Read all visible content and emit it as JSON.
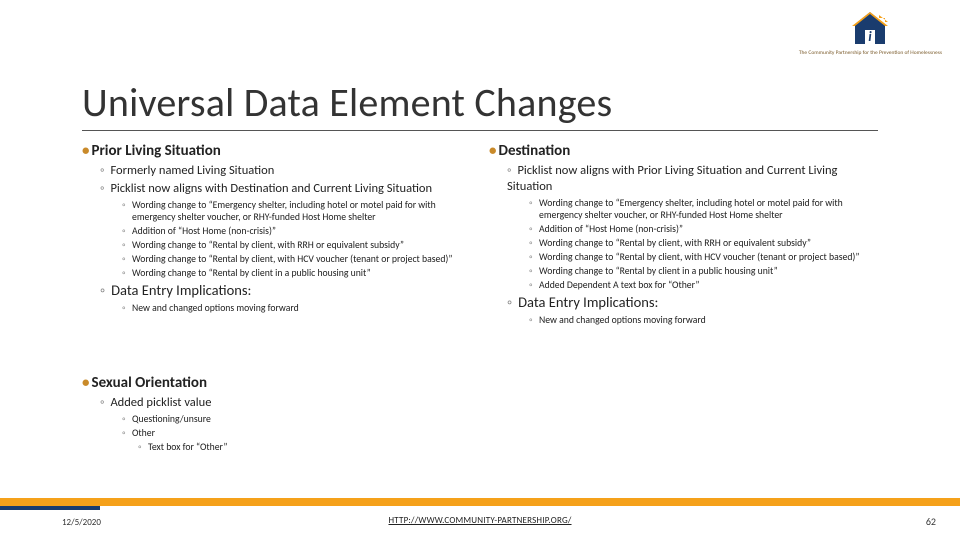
{
  "logo_caption": "The Community Partnership\nfor the Prevention\nof Homelessness",
  "title": "Universal Data Element Changes",
  "left": {
    "heading": "Prior Living Situation",
    "sub": [
      "Formerly named Living Situation",
      "Picklist now aligns with Destination and Current Living Situation"
    ],
    "bullets": [
      "Wording change to “Emergency shelter, including hotel or motel paid for with emergency shelter voucher, or RHY-funded Host Home shelter",
      "Addition of “Host Home (non-crisis)”",
      "Wording change to “Rental by client, with RRH or equivalent subsidy”",
      "Wording change to “Rental by client, with HCV voucher (tenant or project based)”",
      "Wording change to “Rental by client in a public housing unit”"
    ],
    "impl_heading": "Data Entry Implications:",
    "impl_bullets": [
      "New and changed options moving forward"
    ]
  },
  "right": {
    "heading": "Destination",
    "sub": [
      "Picklist now aligns with Prior Living Situation and Current Living Situation"
    ],
    "bullets": [
      "Wording change to “Emergency shelter, including hotel or motel paid for with emergency shelter voucher, or RHY-funded Host Home shelter",
      "Addition of “Host Home (non-crisis)”",
      "Wording change to “Rental by client, with RRH or equivalent subsidy”",
      "Wording change to “Rental by client, with HCV voucher (tenant or project based)”",
      "Wording change to “Rental by client in a public housing unit”",
      "Added Dependent A text box for “Other”"
    ],
    "impl_heading": "Data Entry Implications:",
    "impl_bullets": [
      "New and changed options moving forward"
    ]
  },
  "sexual": {
    "heading": "Sexual Orientation",
    "sub": [
      "Added picklist value"
    ],
    "bullets": [
      "Questioning/unsure",
      "Other"
    ],
    "sub_bullets": [
      "Text box for “Other”"
    ]
  },
  "footer": {
    "date": "12/5/2020",
    "url": "HTTP://WWW.COMMUNITY-PARTNERSHIP.ORG/",
    "page": "62"
  }
}
